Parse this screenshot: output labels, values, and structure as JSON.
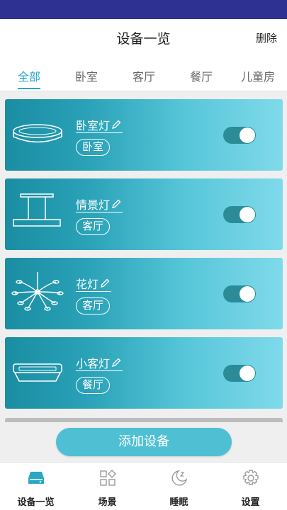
{
  "header": {
    "title": "设备一览",
    "delete_label": "删除"
  },
  "tabs": [
    {
      "label": "全部",
      "active": true
    },
    {
      "label": "卧室",
      "active": false
    },
    {
      "label": "客厅",
      "active": false
    },
    {
      "label": "餐厅",
      "active": false
    },
    {
      "label": "儿童房",
      "active": false
    }
  ],
  "devices": [
    {
      "name": "卧室灯",
      "room": "卧室",
      "icon": "round-ceiling-lamp-icon",
      "on": true
    },
    {
      "name": "情景灯",
      "room": "客厅",
      "icon": "pendant-bar-lamp-icon",
      "on": true
    },
    {
      "name": "花灯",
      "room": "客厅",
      "icon": "chandelier-icon",
      "on": true
    },
    {
      "name": "小客灯",
      "room": "餐厅",
      "icon": "square-ceiling-lamp-icon",
      "on": true
    }
  ],
  "add_button": {
    "label": "添加设备"
  },
  "bottom_nav": [
    {
      "label": "设备一览",
      "icon": "device-list-icon",
      "active": true
    },
    {
      "label": "场景",
      "icon": "scene-grid-icon",
      "active": false
    },
    {
      "label": "睡眠",
      "icon": "sleep-moon-icon",
      "active": false
    },
    {
      "label": "设置",
      "icon": "settings-gear-icon",
      "active": false
    }
  ],
  "colors": {
    "status_bar": "#2f3192",
    "accent": "#2aa7c6",
    "card_gradient_start": "#1a8da2",
    "card_gradient_end": "#7fdaea",
    "toggle_on": "#2b8c98"
  }
}
